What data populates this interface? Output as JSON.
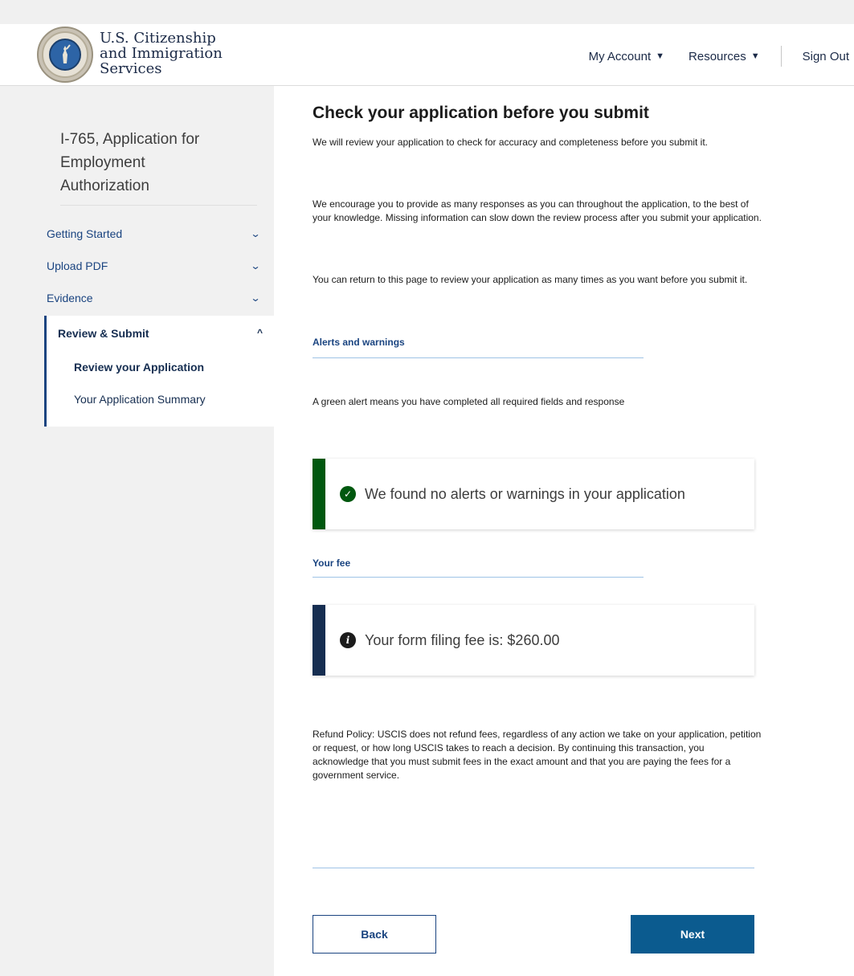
{
  "header": {
    "brand_lines": [
      "U.S. Citizenship",
      "and Immigration",
      "Services"
    ],
    "nav": {
      "my_account": "My Account",
      "resources": "Resources",
      "sign_out": "Sign Out"
    }
  },
  "sidebar": {
    "form_title": "I-765, Application for Employment Authorization",
    "items": [
      {
        "label": "Getting Started",
        "icon": "chevron-down-icon"
      },
      {
        "label": "Upload PDF",
        "icon": "chevron-down-icon"
      },
      {
        "label": "Evidence",
        "icon": "chevron-down-icon"
      }
    ],
    "active_section": {
      "label": "Review & Submit",
      "icon": "chevron-up-icon",
      "subitems": [
        "Review your Application",
        "Your Application Summary"
      ]
    }
  },
  "main": {
    "title": "Check your application before you submit",
    "intro_paragraphs": [
      "We will review your application to check for accuracy and completeness before you submit it.",
      "We encourage you to provide as many responses as you can throughout the application, to the best of your knowledge. Missing information can slow down the review process after you submit your application.",
      "You can return to this page to review your application as many times as you want before you submit it."
    ],
    "alerts_section": {
      "label": "Alerts and warnings",
      "description": "A green alert means you have completed all required fields and response",
      "alert_text": "We found no alerts or warnings in your application",
      "alert_color": "#00580f",
      "icon": "check-circle-icon"
    },
    "fee_section": {
      "label": "Your fee",
      "fee_text": "Your form filing fee is: $260.00",
      "bar_color": "#162e51",
      "icon": "info-circle-icon"
    },
    "refund_policy": "Refund Policy: USCIS does not refund fees, regardless of any action we take on your application, petition or request, or how long USCIS takes to reach a decision. By continuing this transaction, you acknowledge that you must submit fees in the exact amount and that you are paying the fees for a government service.",
    "buttons": {
      "back": "Back",
      "next": "Next"
    }
  }
}
